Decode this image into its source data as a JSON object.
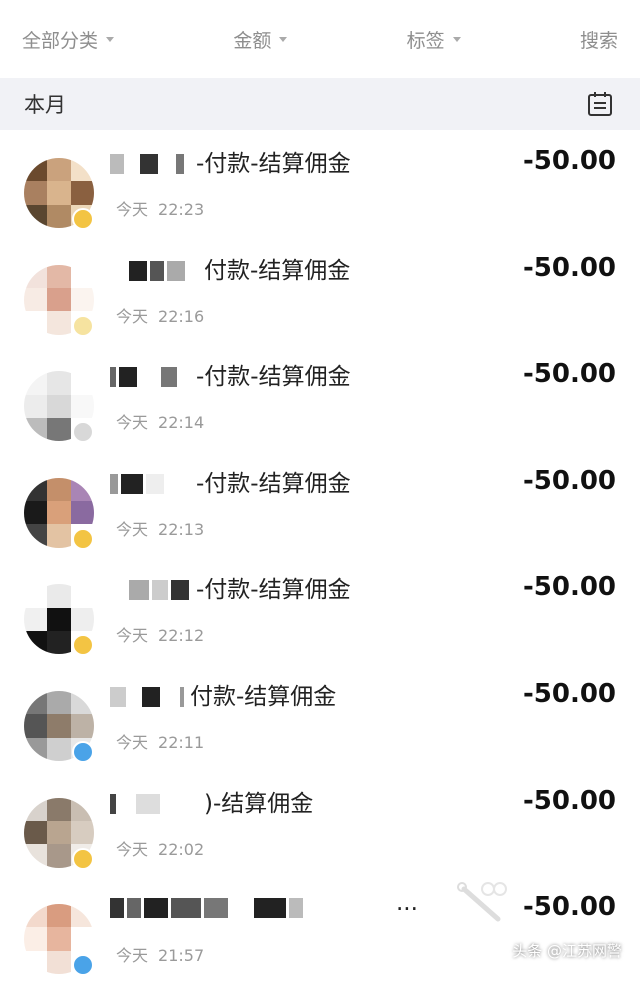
{
  "filters": [
    {
      "label": "全部分类",
      "has_caret": true
    },
    {
      "label": "金额",
      "has_caret": true
    },
    {
      "label": "标签",
      "has_caret": true
    },
    {
      "label": "搜索",
      "has_caret": false
    }
  ],
  "month": {
    "label": "本月",
    "icon": "calendar-icon"
  },
  "transactions": [
    {
      "title": "-付款-结算佣金",
      "date": "今天",
      "time": "22:23",
      "amount": "-50.00",
      "badge_color": "#f3c443"
    },
    {
      "title": "付款-结算佣金",
      "date": "今天",
      "time": "22:16",
      "amount": "-50.00",
      "badge_color": "#f6e3a0"
    },
    {
      "title": "-付款-结算佣金",
      "date": "今天",
      "time": "22:14",
      "amount": "-50.00",
      "badge_color": "#d8d8d8"
    },
    {
      "title": "-付款-结算佣金",
      "date": "今天",
      "time": "22:13",
      "amount": "-50.00",
      "badge_color": "#f3c443"
    },
    {
      "title": "-付款-结算佣金",
      "date": "今天",
      "time": "22:12",
      "amount": "-50.00",
      "badge_color": "#f3c443"
    },
    {
      "title": "付款-结算佣金",
      "date": "今天",
      "time": "22:11",
      "amount": "-50.00",
      "badge_color": "#4aa3e8"
    },
    {
      "title": ")-结算佣金",
      "date": "今天",
      "time": "22:02",
      "amount": "-50.00",
      "badge_color": "#f3c443"
    },
    {
      "title": "...",
      "date": "今天",
      "time": "21:57",
      "amount": "-50.00",
      "badge_color": "#4aa3e8"
    }
  ],
  "watermark": {
    "text": "头条 @江苏网警"
  }
}
